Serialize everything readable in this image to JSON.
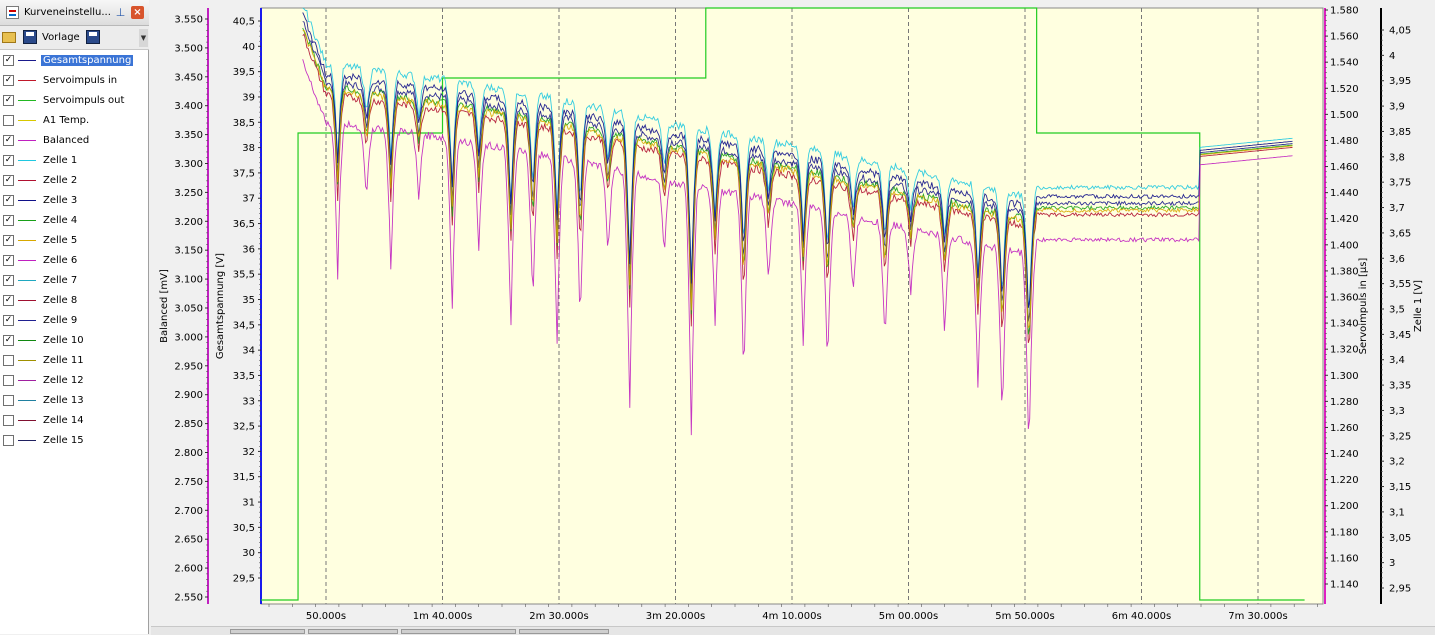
{
  "panel": {
    "title": "Kurveneinstellu...",
    "template_label": "Vorlage"
  },
  "series_list": [
    {
      "label": "Gesamtspannung",
      "checked": true,
      "color": "#1a1a8c",
      "selected": true
    },
    {
      "label": "Servoimpuls in",
      "checked": true,
      "color": "#c0182a"
    },
    {
      "label": "Servoimpuls out",
      "checked": true,
      "color": "#22b822"
    },
    {
      "label": "A1 Temp.",
      "checked": false,
      "color": "#d8c800"
    },
    {
      "label": "Balanced",
      "checked": true,
      "color": "#c020c0"
    },
    {
      "label": "Zelle 1",
      "checked": true,
      "color": "#20c8e0"
    },
    {
      "label": "Zelle 2",
      "checked": true,
      "color": "#b01030"
    },
    {
      "label": "Zelle 3",
      "checked": true,
      "color": "#101088"
    },
    {
      "label": "Zelle 4",
      "checked": true,
      "color": "#18a018"
    },
    {
      "label": "Zelle 5",
      "checked": true,
      "color": "#d8a800"
    },
    {
      "label": "Zelle 6",
      "checked": true,
      "color": "#c020c0"
    },
    {
      "label": "Zelle 7",
      "checked": true,
      "color": "#20a8c0"
    },
    {
      "label": "Zelle 8",
      "checked": true,
      "color": "#a01030"
    },
    {
      "label": "Zelle 9",
      "checked": true,
      "color": "#202090"
    },
    {
      "label": "Zelle 10",
      "checked": true,
      "color": "#108810"
    },
    {
      "label": "Zelle 11",
      "checked": false,
      "color": "#a09000"
    },
    {
      "label": "Zelle 12",
      "checked": false,
      "color": "#a020a0"
    },
    {
      "label": "Zelle 13",
      "checked": false,
      "color": "#2080a0"
    },
    {
      "label": "Zelle 14",
      "checked": false,
      "color": "#801030"
    },
    {
      "label": "Zelle 15",
      "checked": false,
      "color": "#202060"
    }
  ],
  "chart_data": {
    "type": "line",
    "plot_background": "#ffffe0",
    "grid": "vertical-dashed",
    "x_ticks": [
      "50.000s",
      "1m 40.000s",
      "2m 30.000s",
      "3m 20.000s",
      "4m 10.000s",
      "5m 00.000s",
      "5m 50.000s",
      "6m 40.000s",
      "7m 30.000s"
    ],
    "axes": {
      "balanced": {
        "label": "Balanced [mV]",
        "color": "#c020c0",
        "ticks": [
          "3.550",
          "3.500",
          "3.450",
          "3.400",
          "3.350",
          "3.300",
          "3.250",
          "3.200",
          "3.150",
          "3.100",
          "3.050",
          "3.000",
          "2.950",
          "2.900",
          "2.850",
          "2.800",
          "2.750",
          "2.700",
          "2.650",
          "2.600",
          "2.550"
        ]
      },
      "gesamtspannung": {
        "label": "Gesamtspannung [V]",
        "color": "#1a1a8c",
        "ticks": [
          "40,5",
          "40",
          "39,5",
          "39",
          "38,5",
          "38",
          "37,5",
          "37",
          "36,5",
          "36",
          "35,5",
          "35",
          "34,5",
          "34",
          "33,5",
          "33",
          "32,5",
          "32",
          "31,5",
          "31",
          "30,5",
          "30",
          "29,5"
        ]
      },
      "servoimpuls_in": {
        "label": "Servoimpuls in [µs]",
        "color": "#c0182a",
        "ticks": [
          "1.580",
          "1.560",
          "1.540",
          "1.520",
          "1.500",
          "1.480",
          "1.460",
          "1.440",
          "1.420",
          "1.400",
          "1.380",
          "1.360",
          "1.340",
          "1.320",
          "1.300",
          "1.280",
          "1.260",
          "1.240",
          "1.220",
          "1.200",
          "1.180",
          "1.160",
          "1.140"
        ]
      },
      "zelle1": {
        "label": "Zelle 1 [V]",
        "color": "#000000",
        "ticks": [
          "4,05",
          "4",
          "3,95",
          "3,9",
          "3,85",
          "3,8",
          "3,75",
          "3,7",
          "3,65",
          "3,6",
          "3,55",
          "3,5",
          "3,45",
          "3,4",
          "3,35",
          "3,3",
          "3,25",
          "3,2",
          "3,15",
          "3,1",
          "3,05",
          "3",
          "2,95"
        ]
      }
    },
    "approx_trend_gesamtspannung": {
      "x_s": [
        40,
        50,
        100,
        150,
        200,
        250,
        300,
        350,
        400,
        450
      ],
      "y_V": [
        40.5,
        39.3,
        39.0,
        38.6,
        38.1,
        37.7,
        37.2,
        36.7,
        37.4,
        37.8
      ]
    },
    "servoimpuls_out_levels_s": [
      {
        "from": 0,
        "to": 38,
        "level": "low"
      },
      {
        "from": 38,
        "to": 100,
        "level": "mid"
      },
      {
        "from": 100,
        "to": 213,
        "level": "mid-high"
      },
      {
        "from": 213,
        "to": 355,
        "level": "top"
      },
      {
        "from": 355,
        "to": 425,
        "level": "mid"
      },
      {
        "from": 425,
        "to": 470,
        "level": "low"
      }
    ]
  }
}
